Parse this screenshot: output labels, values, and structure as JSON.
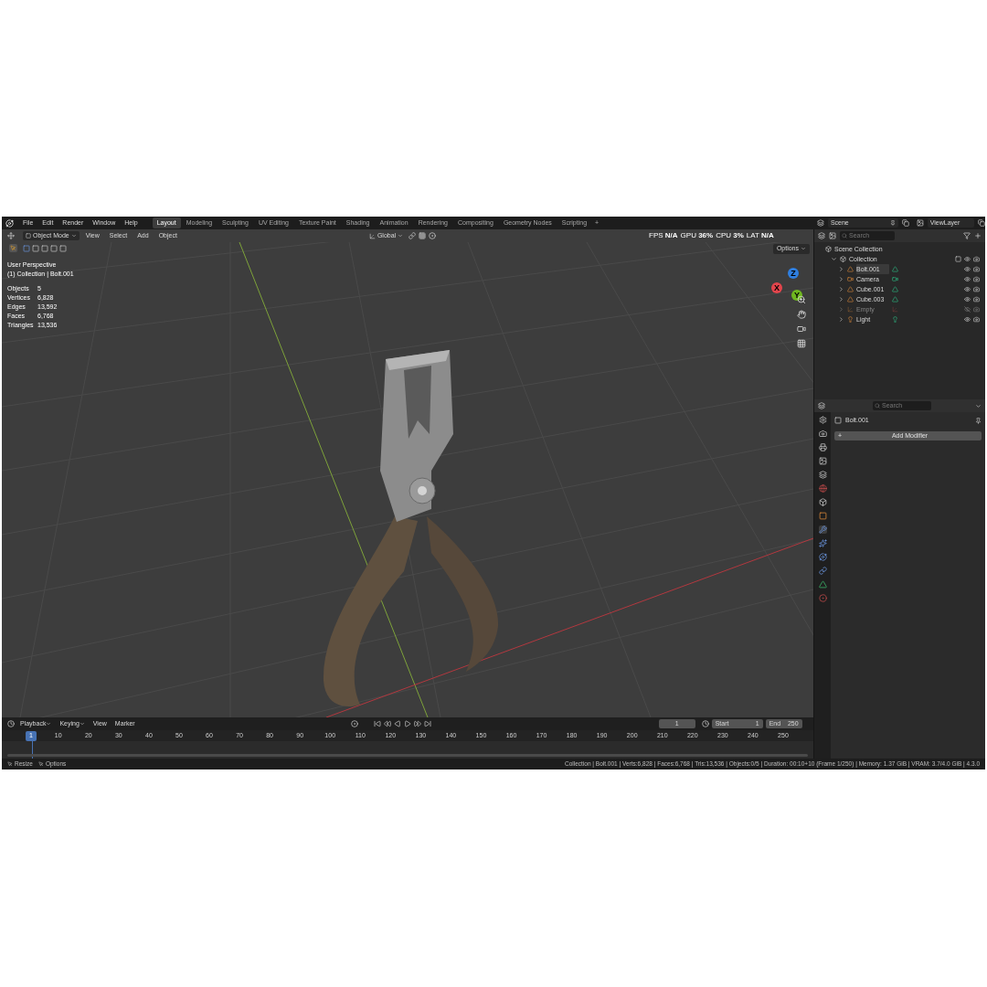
{
  "menus": [
    "File",
    "Edit",
    "Render",
    "Window",
    "Help"
  ],
  "workspaces": [
    {
      "label": "Layout",
      "selected": true
    },
    {
      "label": "Modeling",
      "selected": false
    },
    {
      "label": "Sculpting",
      "selected": false
    },
    {
      "label": "UV Editing",
      "selected": false
    },
    {
      "label": "Texture Paint",
      "selected": false
    },
    {
      "label": "Shading",
      "selected": false
    },
    {
      "label": "Animation",
      "selected": false
    },
    {
      "label": "Rendering",
      "selected": false
    },
    {
      "label": "Compositing",
      "selected": false
    },
    {
      "label": "Geometry Nodes",
      "selected": false
    },
    {
      "label": "Scripting",
      "selected": false
    }
  ],
  "add_workspace": "+",
  "scene": "Scene",
  "view_layer": "ViewLayer",
  "viewport": {
    "mode": "Object Mode",
    "menus": [
      "View",
      "Select",
      "Add",
      "Object"
    ],
    "orientation": "Global",
    "options": "Options",
    "view_name": "User Perspective",
    "context": "(1) Collection | Bolt.001",
    "stats": [
      {
        "label": "Objects",
        "value": "5"
      },
      {
        "label": "Vertices",
        "value": "6,828"
      },
      {
        "label": "Edges",
        "value": "13,592"
      },
      {
        "label": "Faces",
        "value": "6,768"
      },
      {
        "label": "Triangles",
        "value": "13,536"
      }
    ],
    "performance": [
      {
        "label": "FPS",
        "value": "N/A"
      },
      {
        "label": "GPU",
        "value": "36%"
      },
      {
        "label": "CPU",
        "value": "3%"
      },
      {
        "label": "LAT",
        "value": "N/A"
      }
    ],
    "gizmo": [
      {
        "label": "Z",
        "color": "#2f7fe0"
      },
      {
        "label": "X",
        "color": "#e2454c"
      },
      {
        "label": "Y",
        "color": "#6fb81f"
      }
    ]
  },
  "outliner": {
    "search_placeholder": "Search",
    "root": "Scene Collection",
    "collection": {
      "label": "Collection",
      "expanded": true,
      "children": [
        {
          "label": "Bolt.001",
          "kind": "mesh",
          "hidden": false,
          "selected": true
        },
        {
          "label": "Camera",
          "kind": "camera",
          "hidden": false,
          "selected": false
        },
        {
          "label": "Cube.001",
          "kind": "mesh",
          "hidden": false,
          "selected": false
        },
        {
          "label": "Cube.003",
          "kind": "mesh",
          "hidden": false,
          "selected": false
        },
        {
          "label": "Empty",
          "kind": "empty",
          "hidden": true,
          "selected": false
        },
        {
          "label": "Light",
          "kind": "light",
          "hidden": false,
          "selected": false
        }
      ]
    }
  },
  "properties": {
    "search_placeholder": "Search",
    "object_name": "Bolt.001",
    "add_icon": "+",
    "add_modifier": "Add Modifier",
    "tabs": [
      {
        "kind": "tool",
        "selected": false
      },
      {
        "kind": "render",
        "selected": false
      },
      {
        "kind": "output",
        "selected": false
      },
      {
        "kind": "view_layer",
        "selected": false
      },
      {
        "kind": "scene",
        "selected": false
      },
      {
        "kind": "world",
        "selected": false
      },
      {
        "kind": "collection",
        "selected": false
      },
      {
        "kind": "object",
        "selected": false
      },
      {
        "kind": "modifier",
        "selected": true
      },
      {
        "kind": "particles",
        "selected": false
      },
      {
        "kind": "physics",
        "selected": false
      },
      {
        "kind": "constraints",
        "selected": false
      },
      {
        "kind": "data",
        "selected": false
      },
      {
        "kind": "material",
        "selected": false
      }
    ]
  },
  "timeline": {
    "menus": [
      "Playback",
      "Keying",
      "View",
      "Marker"
    ],
    "current_frame": "1",
    "start_label": "Start",
    "start": "1",
    "end_label": "End",
    "end": "250",
    "frames": [
      {
        "label": "1",
        "selected": true
      },
      {
        "label": "10",
        "selected": false
      },
      {
        "label": "20",
        "selected": false
      },
      {
        "label": "30",
        "selected": false
      },
      {
        "label": "40",
        "selected": false
      },
      {
        "label": "50",
        "selected": false
      },
      {
        "label": "60",
        "selected": false
      },
      {
        "label": "70",
        "selected": false
      },
      {
        "label": "80",
        "selected": false
      },
      {
        "label": "90",
        "selected": false
      },
      {
        "label": "100",
        "selected": false
      },
      {
        "label": "110",
        "selected": false
      },
      {
        "label": "120",
        "selected": false
      },
      {
        "label": "130",
        "selected": false
      },
      {
        "label": "140",
        "selected": false
      },
      {
        "label": "150",
        "selected": false
      },
      {
        "label": "160",
        "selected": false
      },
      {
        "label": "170",
        "selected": false
      },
      {
        "label": "180",
        "selected": false
      },
      {
        "label": "190",
        "selected": false
      },
      {
        "label": "200",
        "selected": false
      },
      {
        "label": "210",
        "selected": false
      },
      {
        "label": "220",
        "selected": false
      },
      {
        "label": "230",
        "selected": false
      },
      {
        "label": "240",
        "selected": false
      },
      {
        "label": "250",
        "selected": false
      }
    ]
  },
  "status_bar": {
    "left": [
      "Resize",
      "Options"
    ],
    "info": "Collection | Bolt.001 | Verts:6,828 | Faces:6,768 | Tris:13,536 | Objects:0/5 | Duration: 00:10+10 (Frame 1/250) | Memory: 1.37 GiB | VRAM: 3.7/4.0 GiB | 4.3.0"
  }
}
